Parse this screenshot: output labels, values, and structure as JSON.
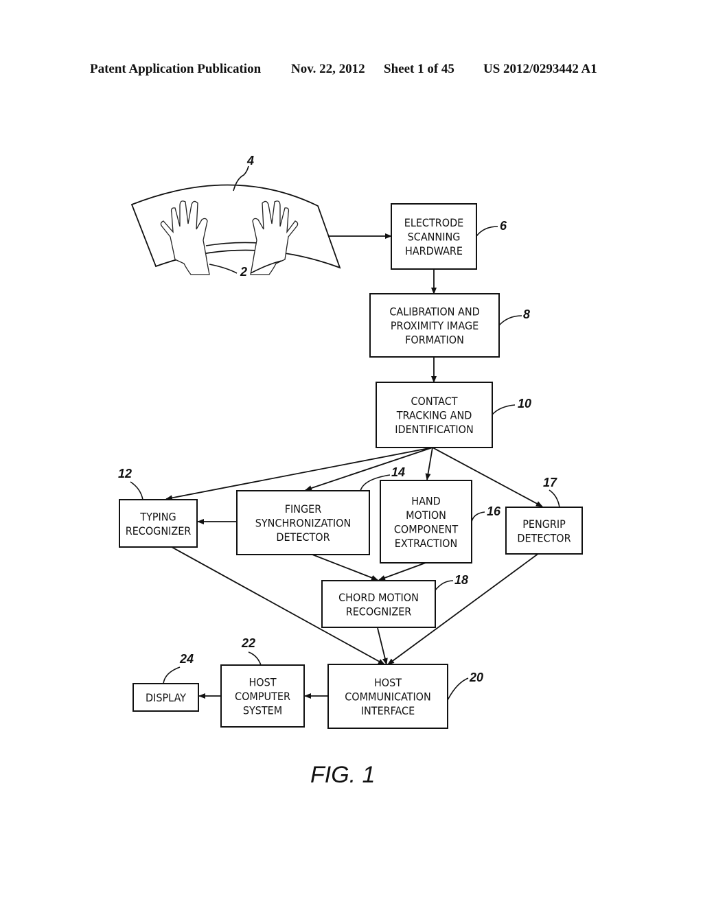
{
  "header": {
    "left": "Patent Application Publication",
    "date": "Nov. 22, 2012",
    "sheet": "Sheet 1 of 45",
    "number": "US 2012/0293442 A1"
  },
  "figure": {
    "caption": "FIG. 1",
    "surface": {
      "ref": "4",
      "hands_ref": "2"
    },
    "blocks": [
      {
        "id": "electrode",
        "ref": "6",
        "lines": [
          "ELECTRODE",
          "SCANNING",
          "HARDWARE"
        ]
      },
      {
        "id": "calibration",
        "ref": "8",
        "lines": [
          "CALIBRATION AND",
          "PROXIMITY IMAGE",
          "FORMATION"
        ]
      },
      {
        "id": "contact",
        "ref": "10",
        "lines": [
          "CONTACT",
          "TRACKING AND",
          "IDENTIFICATION"
        ]
      },
      {
        "id": "typing",
        "ref": "12",
        "lines": [
          "TYPING",
          "RECOGNIZER"
        ]
      },
      {
        "id": "finger",
        "ref": "14",
        "lines": [
          "FINGER",
          "SYNCHRONIZATION",
          "DETECTOR"
        ]
      },
      {
        "id": "hand",
        "ref": "16",
        "lines": [
          "HAND",
          "MOTION",
          "COMPONENT",
          "EXTRACTION"
        ]
      },
      {
        "id": "pengrip",
        "ref": "17",
        "lines": [
          "PENGRIP",
          "DETECTOR"
        ]
      },
      {
        "id": "chord",
        "ref": "18",
        "lines": [
          "CHORD MOTION",
          "RECOGNIZER"
        ]
      },
      {
        "id": "hostcomm",
        "ref": "20",
        "lines": [
          "HOST",
          "COMMUNICATION",
          "INTERFACE"
        ]
      },
      {
        "id": "hostcomp",
        "ref": "22",
        "lines": [
          "HOST",
          "COMPUTER",
          "SYSTEM"
        ]
      },
      {
        "id": "display",
        "ref": "24",
        "lines": [
          "DISPLAY"
        ]
      }
    ]
  }
}
